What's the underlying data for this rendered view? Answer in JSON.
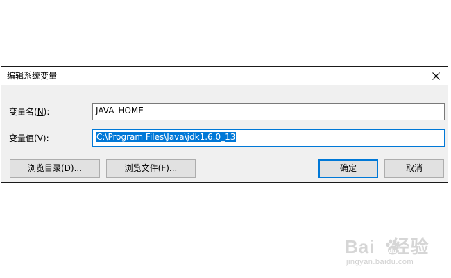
{
  "dialog": {
    "title": "编辑系统变量",
    "close_glyph": "✕"
  },
  "fields": {
    "name": {
      "label_prefix": "变量名(",
      "label_accel": "N",
      "label_suffix": "):",
      "value": "JAVA_HOME"
    },
    "value": {
      "label_prefix": "变量值(",
      "label_accel": "V",
      "label_suffix": "):",
      "value": "C:\\Program Files\\Java\\jdk1.6.0_13",
      "selected": true
    }
  },
  "buttons": {
    "browse_dir": {
      "prefix": "浏览目录(",
      "accel": "D",
      "suffix": ")..."
    },
    "browse_file": {
      "prefix": "浏览文件(",
      "accel": "F",
      "suffix": ")..."
    },
    "ok": {
      "label": "确定"
    },
    "cancel": {
      "label": "取消"
    }
  },
  "watermark": {
    "brand": "Bai",
    "brand_tail": "经验",
    "url": "jingyan.baidu.com"
  },
  "colors": {
    "accent": "#0078d7",
    "dialog_bg": "#f0f0f0",
    "button_bg": "#e1e1e1"
  },
  "icons": {
    "close": "close-icon",
    "watermark_paw": "paw-icon"
  }
}
